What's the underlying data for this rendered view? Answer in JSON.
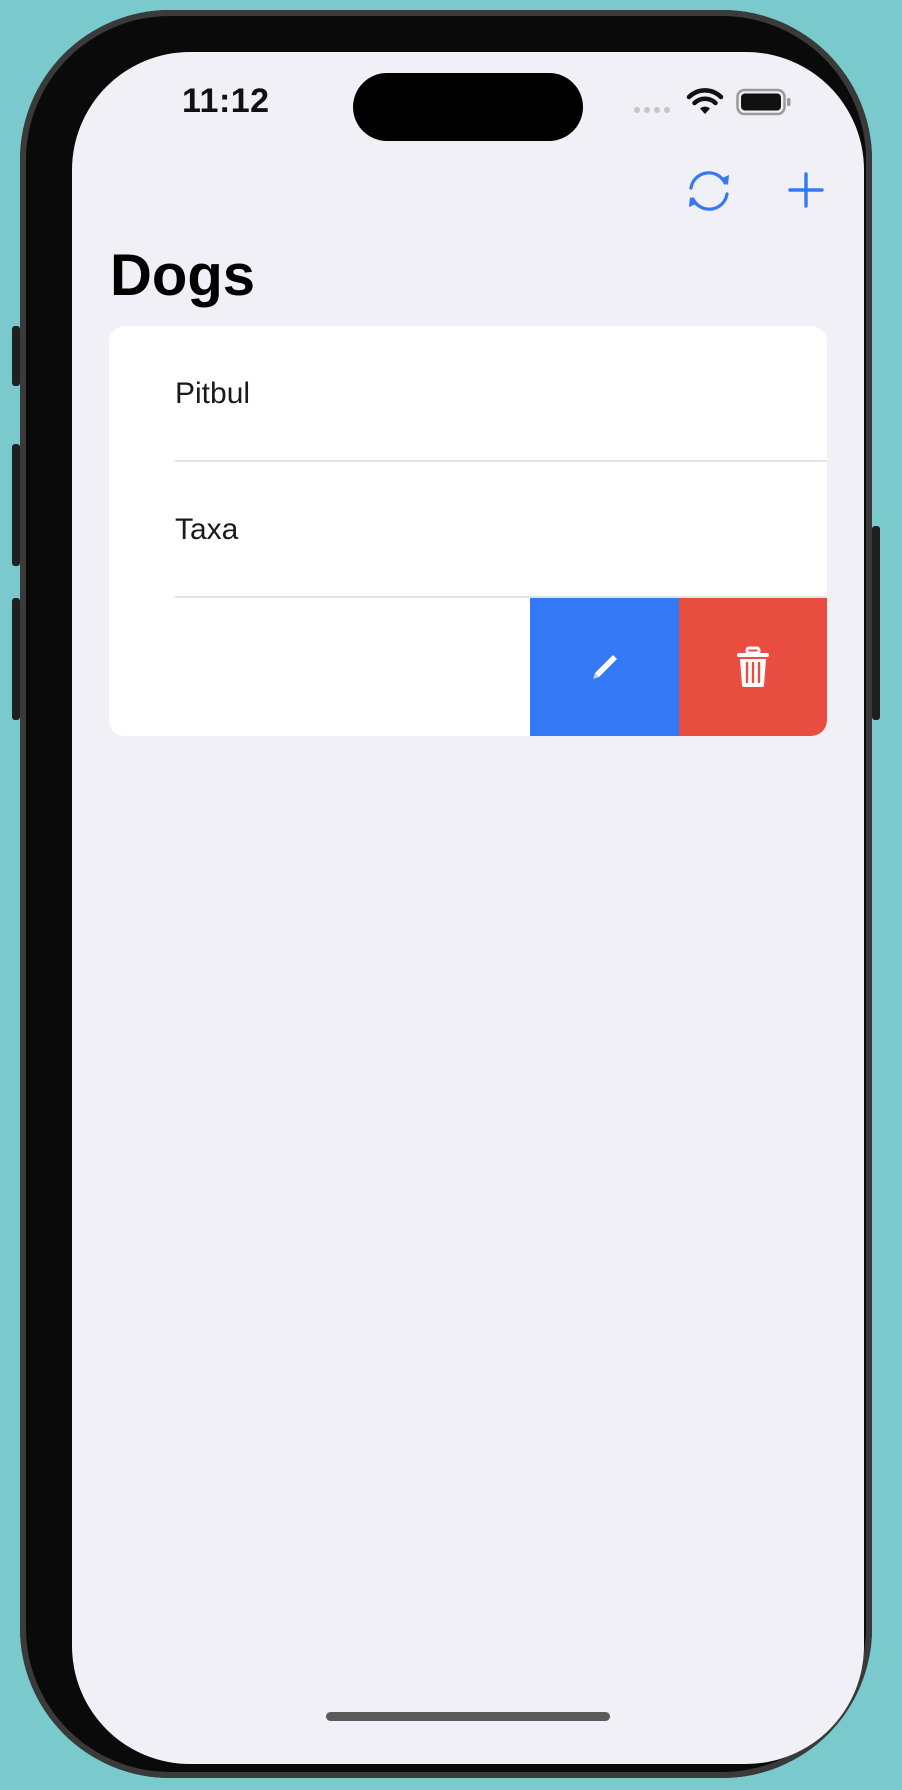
{
  "status_bar": {
    "time": "11:12",
    "wifi_icon": "wifi-icon",
    "battery_icon": "battery-icon"
  },
  "nav_bar": {
    "sync_icon": "arrow-triangle-2-circlepath-icon",
    "add_icon": "plus-icon",
    "accent_color": "#3478f6"
  },
  "page": {
    "title": "Dogs"
  },
  "list": {
    "items": [
      {
        "label": "Pitbul"
      },
      {
        "label": "Taxa"
      },
      {
        "label": ""
      }
    ],
    "swipe_actions": {
      "edit_icon": "pencil-icon",
      "edit_color": "#3478f6",
      "delete_icon": "trash-icon",
      "delete_color": "#e84f40"
    }
  }
}
